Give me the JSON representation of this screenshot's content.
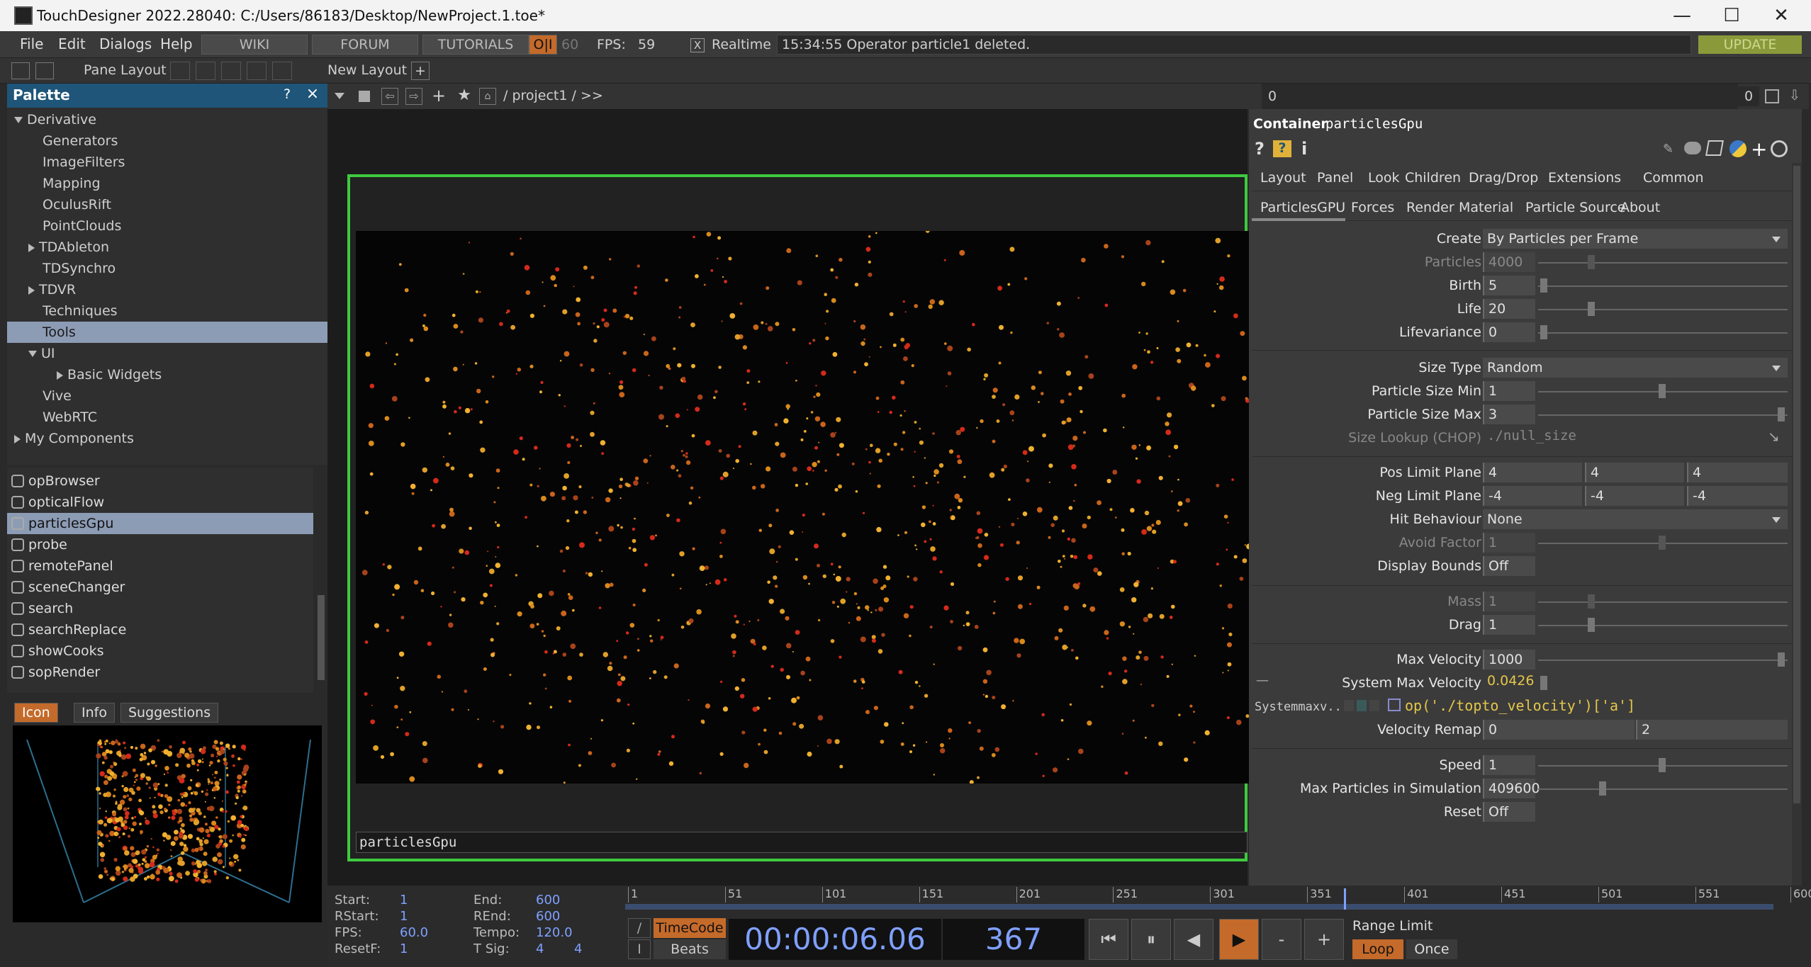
{
  "window": {
    "title": "TouchDesigner 2022.28040: C:/Users/86183/Desktop/NewProject.1.toe*",
    "minimize": "—",
    "maximize": "☐",
    "close": "✕"
  },
  "menubar": {
    "items": [
      "File",
      "Edit",
      "Dialogs",
      "Help"
    ],
    "wiki": "WIKI",
    "forum": "FORUM",
    "tutorials": "TUTORIALS",
    "oi": "O|I",
    "fps_cap": "60",
    "fps_label": "FPS:",
    "fps_value": "59",
    "realtime_check": "X",
    "realtime_label": "Realtime",
    "status": "15:34:55 Operator particle1 deleted.",
    "update": "UPDATE"
  },
  "toolbar": {
    "pane_layout": "Pane Layout",
    "new_layout": "New Layout",
    "add": "+"
  },
  "palette": {
    "title": "Palette",
    "help": "?",
    "close": "×",
    "tree": [
      {
        "label": "Derivative",
        "indent": 0,
        "arrow": "down"
      },
      {
        "label": "Generators",
        "indent": 2,
        "arrow": ""
      },
      {
        "label": "ImageFilters",
        "indent": 2,
        "arrow": ""
      },
      {
        "label": "Mapping",
        "indent": 2,
        "arrow": ""
      },
      {
        "label": "OculusRift",
        "indent": 2,
        "arrow": ""
      },
      {
        "label": "PointClouds",
        "indent": 2,
        "arrow": ""
      },
      {
        "label": "TDAbleton",
        "indent": 1,
        "arrow": "right"
      },
      {
        "label": "TDSynchro",
        "indent": 2,
        "arrow": ""
      },
      {
        "label": "TDVR",
        "indent": 1,
        "arrow": "right"
      },
      {
        "label": "Techniques",
        "indent": 2,
        "arrow": ""
      },
      {
        "label": "Tools",
        "indent": 2,
        "arrow": "",
        "selected": true
      },
      {
        "label": "UI",
        "indent": 1,
        "arrow": "down"
      },
      {
        "label": "Basic Widgets",
        "indent": 3,
        "arrow": "right"
      },
      {
        "label": "Vive",
        "indent": 2,
        "arrow": ""
      },
      {
        "label": "WebRTC",
        "indent": 2,
        "arrow": ""
      },
      {
        "label": "My Components",
        "indent": 0,
        "arrow": "right"
      }
    ],
    "components": [
      "opBrowser",
      "opticalFlow",
      "particlesGpu",
      "probe",
      "remotePanel",
      "sceneChanger",
      "search",
      "searchReplace",
      "showCooks",
      "sopRender"
    ],
    "selected_component": "particlesGpu",
    "tabs": {
      "icon": "Icon",
      "info": "Info",
      "suggestions": "Suggestions"
    }
  },
  "network": {
    "path": "/ project1 / >>",
    "counter": "0",
    "node_name": "particlesGpu"
  },
  "params": {
    "type": "Container",
    "name": "particlesGpu",
    "tabs_row1": [
      "Layout",
      "Panel",
      "Look",
      "Children",
      "Drag/Drop",
      "Extensions",
      "Common"
    ],
    "tabs_row2": [
      "ParticlesGPU",
      "Forces",
      "Render",
      "Material",
      "Particle Source",
      "About"
    ],
    "create_label": "Create",
    "create_value": "By Particles per Frame",
    "particles_label": "Particles",
    "particles_value": "4000",
    "birth_label": "Birth",
    "birth_value": "5",
    "life_label": "Life",
    "life_value": "20",
    "lifevariance_label": "Lifevariance",
    "lifevariance_value": "0",
    "sizetype_label": "Size Type",
    "sizetype_value": "Random",
    "sizemin_label": "Particle Size Min",
    "sizemin_value": "1",
    "sizemax_label": "Particle Size Max",
    "sizemax_value": "3",
    "sizelookup_label": "Size Lookup (CHOP)",
    "sizelookup_value": "./null_size",
    "poslimit_label": "Pos Limit Plane",
    "poslimit_values": [
      "4",
      "4",
      "4"
    ],
    "neglimit_label": "Neg Limit Plane",
    "neglimit_values": [
      "-4",
      "-4",
      "-4"
    ],
    "hit_label": "Hit Behaviour",
    "hit_value": "None",
    "avoid_label": "Avoid Factor",
    "avoid_value": "1",
    "bounds_label": "Display Bounds",
    "bounds_value": "Off",
    "mass_label": "Mass",
    "mass_value": "1",
    "drag_label": "Drag",
    "drag_value": "1",
    "maxvel_label": "Max Velocity",
    "maxvel_value": "1000",
    "sysmaxvel_label": "System Max Velocity",
    "sysmaxvel_value": "0.0426",
    "sysmaxvel_expr_label": "Systemmaxv..",
    "sysmaxvel_expr": "op('./topto_velocity')['a']",
    "velremap_label": "Velocity Remap",
    "velremap_values": [
      "0",
      "2"
    ],
    "speed_label": "Speed",
    "speed_value": "1",
    "maxparticles_label": "Max Particles in Simulation",
    "maxparticles_value": "409600",
    "reset_label": "Reset",
    "reset_value": "Off"
  },
  "timeline": {
    "start_label": "Start:",
    "start": "1",
    "end_label": "End:",
    "end": "600",
    "rstart_label": "RStart:",
    "rstart": "1",
    "rend_label": "REnd:",
    "rend": "600",
    "fps_label": "FPS:",
    "fps": "60.0",
    "tempo_label": "Tempo:",
    "tempo": "120.0",
    "resetf_label": "ResetF:",
    "resetf": "1",
    "tsig_label": "T Sig:",
    "tsig_a": "4",
    "tsig_b": "4",
    "ticks": [
      "1",
      "51",
      "101",
      "151",
      "201",
      "251",
      "301",
      "351",
      "401",
      "451",
      "501",
      "551",
      "600"
    ],
    "timecode_btn": "TimeCode",
    "beats_btn": "Beats",
    "timecode": "00:00:06.06",
    "frame": "367",
    "range_limit": "Range Limit",
    "loop": "Loop",
    "once": "Once"
  }
}
